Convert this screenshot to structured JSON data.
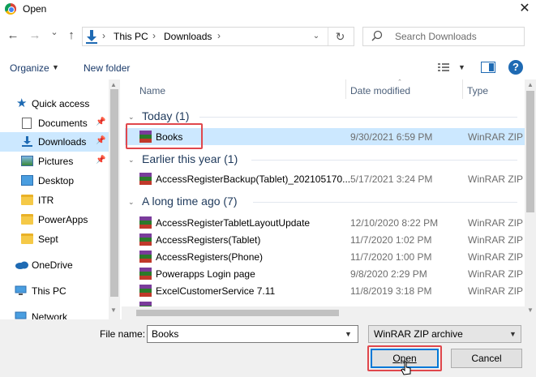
{
  "window": {
    "title": "Open",
    "close_glyph": "✕"
  },
  "nav": {
    "back_icon": "←",
    "forward_icon": "→",
    "dropdown_icon": "⌄",
    "up_icon": "↑",
    "breadcrumb": [
      "This PC",
      "Downloads"
    ],
    "sep": "›",
    "refresh_icon": "↻",
    "search_placeholder": "Search Downloads"
  },
  "toolbar": {
    "organize": "Organize",
    "new_folder": "New folder",
    "help": "?"
  },
  "sidebar": {
    "items": [
      {
        "label": "Quick access",
        "icon": "star-icon",
        "pinned": false
      },
      {
        "label": "Documents",
        "icon": "documents-icon",
        "pinned": true
      },
      {
        "label": "Downloads",
        "icon": "downloads-icon",
        "pinned": true,
        "selected": true
      },
      {
        "label": "Pictures",
        "icon": "pictures-icon",
        "pinned": true
      },
      {
        "label": "Desktop",
        "icon": "desktop-icon",
        "pinned": false
      },
      {
        "label": "ITR",
        "icon": "folder-icon",
        "pinned": false
      },
      {
        "label": "PowerApps",
        "icon": "folder-icon",
        "pinned": false
      },
      {
        "label": "Sept",
        "icon": "folder-icon",
        "pinned": false
      },
      {
        "label": "OneDrive",
        "icon": "cloud-icon",
        "pinned": false
      },
      {
        "label": "This PC",
        "icon": "computer-icon",
        "pinned": false
      },
      {
        "label": "Network",
        "icon": "network-icon",
        "pinned": false
      }
    ]
  },
  "columns": {
    "name": "Name",
    "date": "Date modified",
    "type": "Type"
  },
  "groups": [
    {
      "title": "Today (1)",
      "files": [
        {
          "name": "Books",
          "date": "9/30/2021 6:59 PM",
          "type": "WinRAR ZIP a",
          "selected": true
        }
      ]
    },
    {
      "title": "Earlier this year (1)",
      "files": [
        {
          "name": "AccessRegisterBackup(Tablet)_202105170...",
          "date": "5/17/2021 3:24 PM",
          "type": "WinRAR ZIP a"
        }
      ]
    },
    {
      "title": "A long time ago (7)",
      "files": [
        {
          "name": "AccessRegisterTabletLayoutUpdate",
          "date": "12/10/2020 8:22 PM",
          "type": "WinRAR ZIP a"
        },
        {
          "name": "AccessRegisters(Tablet)",
          "date": "11/7/2020 1:02 PM",
          "type": "WinRAR ZIP a"
        },
        {
          "name": "AccessRegisters(Phone)",
          "date": "11/7/2020 1:00 PM",
          "type": "WinRAR ZIP a"
        },
        {
          "name": "Powerapps Login page",
          "date": "9/8/2020 2:29 PM",
          "type": "WinRAR ZIP a"
        },
        {
          "name": "ExcelCustomerService 7.11",
          "date": "11/8/2019 3:18 PM",
          "type": "WinRAR ZIP a"
        }
      ]
    }
  ],
  "footer": {
    "file_name_label": "File name:",
    "file_name_value": "Books",
    "file_type": "WinRAR ZIP archive",
    "open_label": "Open",
    "cancel_label": "Cancel"
  },
  "colors": {
    "accent": "#0078d7",
    "selection": "#cce8ff",
    "highlight_box": "#e0474c"
  }
}
